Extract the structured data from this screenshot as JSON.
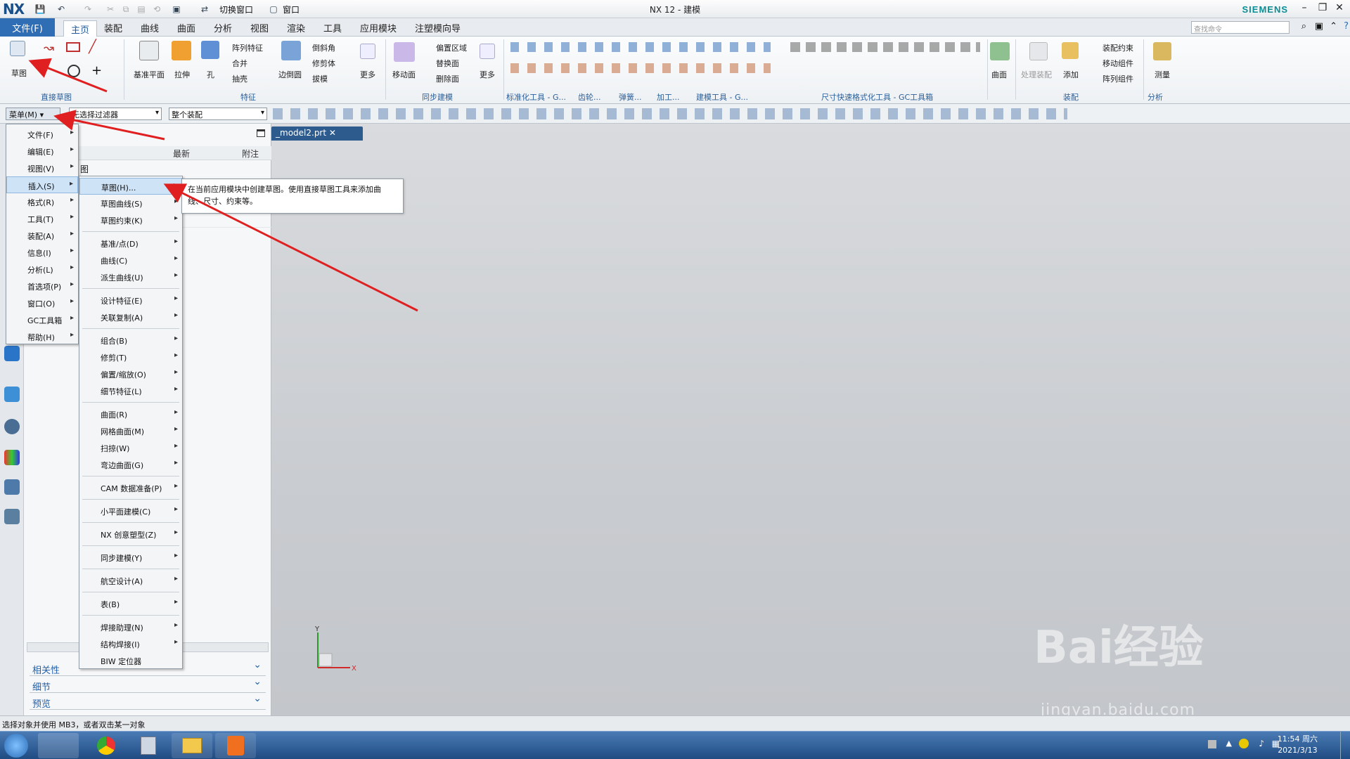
{
  "window": {
    "app_logo": "NX",
    "title": "NX 12 - 建模",
    "brand": "SIEMENS",
    "switch_window": "切换窗口",
    "window_menu": "窗口"
  },
  "tabs": {
    "file": "文件(F)",
    "items": [
      "主页",
      "装配",
      "曲线",
      "曲面",
      "分析",
      "视图",
      "渲染",
      "工具",
      "应用模块",
      "注塑模向导"
    ],
    "active": "主页",
    "find_placeholder": "查找命令"
  },
  "ribbon": {
    "sketch": "草图",
    "basic_plane": "基准平面",
    "extrude": "拉伸",
    "hole": "孔",
    "pattern_feature": "阵列特征",
    "unite": "合并",
    "shell": "抽壳",
    "edge_blend": "边倒圆",
    "chamfer": "倒斜角",
    "trim_body": "修剪体",
    "draft": "拔模",
    "more": "更多",
    "move_face": "移动面",
    "offset_region": "偏置区域",
    "replace_face": "替换面",
    "delete_face": "删除面",
    "more2": "更多",
    "surface": "曲面",
    "process_assembly": "处理装配",
    "add": "添加",
    "assembly_constraint": "装配约束",
    "move_component": "移动组件",
    "pattern_component": "阵列组件",
    "measure": "测量",
    "groups": {
      "direct_sketch": "直接草图",
      "feature": "特征",
      "sync_modeling": "同步建模",
      "std_tools": "标准化工具 - G...",
      "gear": "齿轮...",
      "spring": "弹簧...",
      "machining": "加工...",
      "modeling_tools": "建模工具 - G...",
      "dim_tools": "尺寸快速格式化工具 - GC工具箱",
      "assembly": "装配",
      "analysis": "分析"
    }
  },
  "toolbar2": {
    "menu_button": "菜单(M)",
    "filter": "无选择过滤器",
    "scope": "整个装配"
  },
  "main_menu": [
    "文件(F)",
    "编辑(E)",
    "视图(V)",
    "插入(S)",
    "格式(R)",
    "工具(T)",
    "装配(A)",
    "信息(I)",
    "分析(L)",
    "首选项(P)",
    "窗口(O)",
    "GC工具箱",
    "帮助(H)"
  ],
  "main_menu_active": "插入(S)",
  "insert_menu": [
    {
      "label": "草图(H)..."
    },
    {
      "label": "草图曲线(S)"
    },
    {
      "label": "草图约束(K)"
    },
    {
      "label": "基准/点(D)"
    },
    {
      "label": "曲线(C)"
    },
    {
      "label": "派生曲线(U)"
    },
    {
      "label": "设计特征(E)"
    },
    {
      "label": "关联复制(A)"
    },
    {
      "label": "组合(B)"
    },
    {
      "label": "修剪(T)"
    },
    {
      "label": "偏置/缩放(O)"
    },
    {
      "label": "细节特征(L)"
    },
    {
      "label": "曲面(R)"
    },
    {
      "label": "网格曲面(M)"
    },
    {
      "label": "扫掠(W)"
    },
    {
      "label": "弯边曲面(G)"
    },
    {
      "label": "CAM 数据准备(P)"
    },
    {
      "label": "小平面建模(C)"
    },
    {
      "label": "NX 创意塑型(Z)"
    },
    {
      "label": "同步建模(Y)"
    },
    {
      "label": "航空设计(A)"
    },
    {
      "label": "表(B)"
    },
    {
      "label": "焊接助理(N)"
    },
    {
      "label": "结构焊接(I)"
    },
    {
      "label": "BIW 定位器"
    }
  ],
  "tooltip": {
    "line1": "在当前应用模块中创建草图。使用直接草图工具来添加曲",
    "line2": "线、尺寸、约束等。"
  },
  "panel": {
    "col_latest": "最新",
    "col_note": "附注",
    "row_fragment": "图",
    "accordions": [
      "相关性",
      "细节",
      "预览"
    ]
  },
  "doc_tab": "_model2.prt",
  "status": "选择对象并使用 MB3，或者双击某一对象",
  "clock": {
    "time": "11:54 周六",
    "date": "2021/3/13"
  },
  "triad": {
    "x": "X",
    "y": "Y"
  },
  "watermark": {
    "main": "Bai经验",
    "sub": "jingyan.baidu.com"
  },
  "colors": {
    "accent": "#2f6db5",
    "arrow": "#e02020",
    "highlight": "#cfe3f7"
  }
}
